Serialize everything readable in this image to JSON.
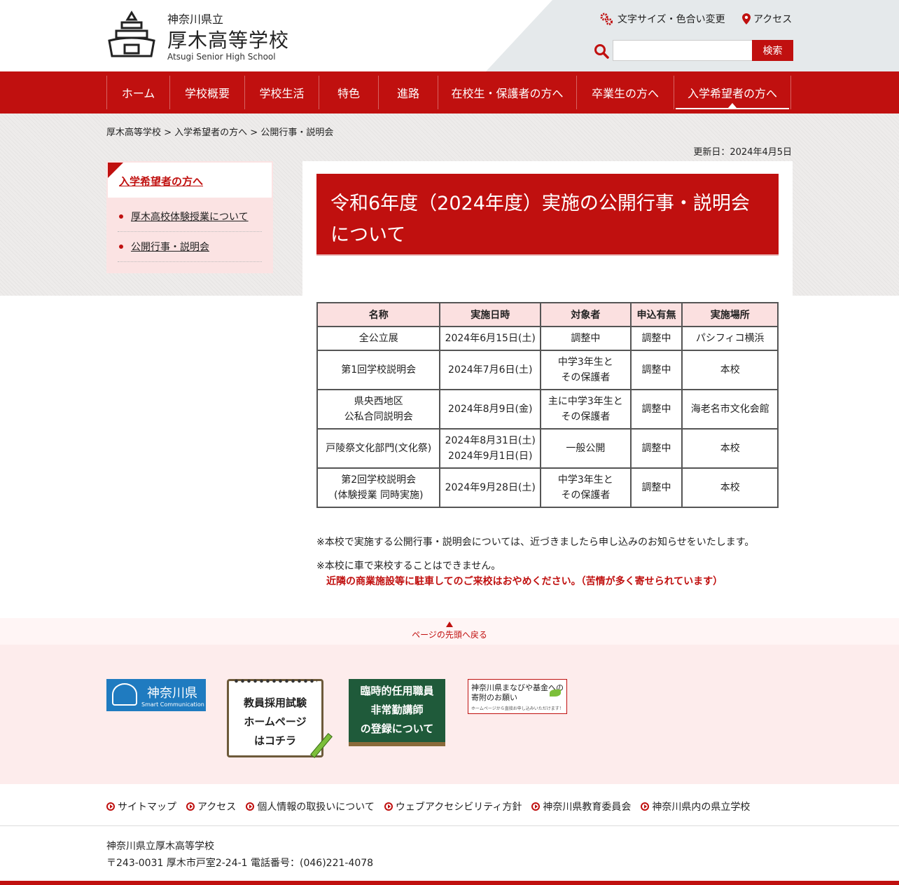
{
  "header": {
    "pref": "神奈川県立",
    "school_name": "厚木高等学校",
    "school_en": "Atsugi Senior High School",
    "font_color_link": "文字サイズ・色合い変更",
    "access_link": "アクセス",
    "search_placeholder": "",
    "search_button": "検索"
  },
  "nav": {
    "items": [
      "ホーム",
      "学校概要",
      "学校生活",
      "特色",
      "進路",
      "在校生・保護者の方へ",
      "卒業生の方へ",
      "入学希望者の方へ"
    ],
    "active_index": 7
  },
  "breadcrumb": "厚木高等学校 > 入学希望者の方へ > 公開行事・説明会",
  "updated": "更新日：2024年4月5日",
  "sidebar": {
    "title": "入学希望者の方へ",
    "items": [
      "厚木高校体験授業について",
      "公開行事・説明会"
    ]
  },
  "main": {
    "title": "令和6年度（2024年度）実施の公開行事・説明会について",
    "table": {
      "headers": [
        "名称",
        "実施日時",
        "対象者",
        "申込有無",
        "実施場所"
      ],
      "rows": [
        [
          "全公立展",
          "2024年6月15日(土)",
          "調整中",
          "調整中",
          "パシフィコ横浜"
        ],
        [
          "第1回学校説明会",
          "2024年7月6日(土)",
          "中学3年生と\nその保護者",
          "調整中",
          "本校"
        ],
        [
          "県央西地区\n公私合同説明会",
          "2024年8月9日(金)",
          "主に中学3年生と\nその保護者",
          "調整中",
          "海老名市文化会館"
        ],
        [
          "戸陵祭文化部門(文化祭)",
          "2024年8月31日(土)\n2024年9月1日(日)",
          "一般公開",
          "調整中",
          "本校"
        ],
        [
          "第2回学校説明会\n(体験授業 同時実施)",
          "2024年9月28日(土)",
          "中学3年生と\nその保護者",
          "調整中",
          "本校"
        ]
      ]
    },
    "note1": "※本校で実施する公開行事・説明会については、近づきましたら申し込みのお知らせをいたします。",
    "note2": "※本校に車で来校することはできません。",
    "note2_red": "近隣の商業施設等に駐車してのご来校はおやめください。（苦情が多く寄せられています）"
  },
  "pagetop": "ページの先頭へ戻る",
  "banners": {
    "kanagawa": "神奈川県",
    "kanagawa_en": "Smart Communication",
    "recruit": [
      "教員採用試験",
      "ホームページ",
      "はコチラ"
    ],
    "temp": [
      "臨時的任用職員",
      "非常勤講師",
      "の登録について"
    ],
    "manabiya": [
      "神奈川県まなびや基金への",
      "寄附のお願い"
    ],
    "manabiya_small": "ホームページから直接お申し込みいただけます！"
  },
  "footer": {
    "links": [
      "サイトマップ",
      "アクセス",
      "個人情報の取扱いについて",
      "ウェブアクセシビリティ方針",
      "神奈川県教育委員会",
      "神奈川県内の県立学校"
    ],
    "name": "神奈川県立厚木高等学校",
    "address": "〒243-0031 厚木市戸室2-24-1 電話番号：(046)221-4078"
  },
  "colors": {
    "accent": "#c0100f",
    "table_header": "#fbe0e0",
    "sidebar_bg": "#fbe3e3"
  }
}
